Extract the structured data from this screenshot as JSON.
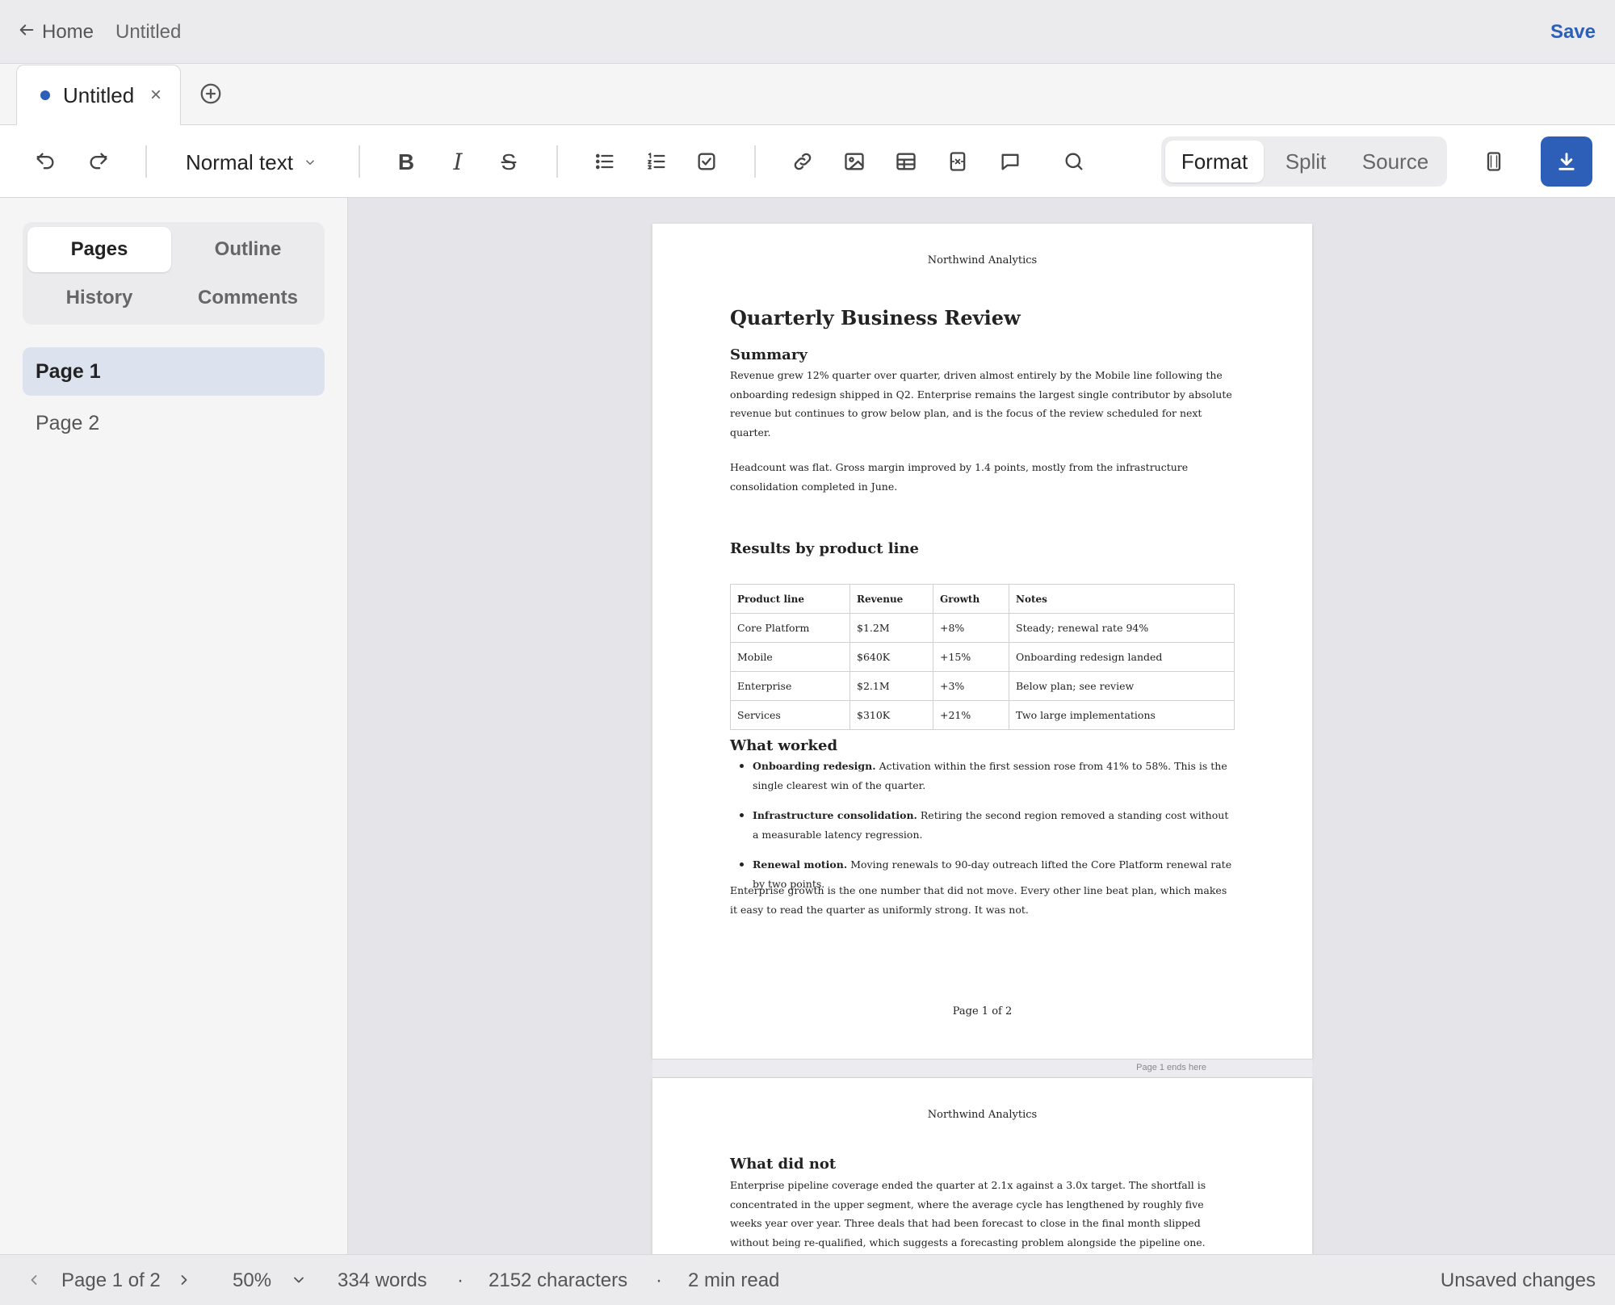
{
  "topbar": {
    "home_label": "Home",
    "doc_title": "Untitled",
    "save_label": "Save"
  },
  "tab": {
    "label": "Untitled",
    "close_glyph": "×"
  },
  "toolbar": {
    "text_style": "Normal text",
    "bold": "B",
    "italic": "I",
    "strike": "S",
    "modes": [
      "Format",
      "Split",
      "Source"
    ],
    "active_mode": "Format"
  },
  "sidebar": {
    "tabs": [
      "Pages",
      "Outline",
      "History",
      "Comments"
    ],
    "active_tab": "Pages",
    "pages": [
      "Page 1",
      "Page 2"
    ],
    "active_page": "Page 1"
  },
  "document": {
    "page1": {
      "header": "Northwind Analytics",
      "title": "Quarterly Business Review",
      "summary_heading": "Summary",
      "summary_p1": "Revenue grew 12% quarter over quarter, driven almost entirely by the Mobile line following the onboarding redesign shipped in Q2. Enterprise remains the largest single contributor by absolute revenue but continues to grow below plan, and is the focus of the review scheduled for next quarter.",
      "summary_p2": "Headcount was flat. Gross margin improved by 1.4 points, mostly from the infrastructure consolidation completed in June.",
      "results_heading": "Results by product line",
      "table": {
        "headers": [
          "Product line",
          "Revenue",
          "Growth",
          "Notes"
        ],
        "rows": [
          [
            "Core Platform",
            "$1.2M",
            "+8%",
            "Steady; renewal rate 94%"
          ],
          [
            "Mobile",
            "$640K",
            "+15%",
            "Onboarding redesign landed"
          ],
          [
            "Enterprise",
            "$2.1M",
            "+3%",
            "Below plan; see review"
          ],
          [
            "Services",
            "$310K",
            "+21%",
            "Two large implementations"
          ]
        ]
      },
      "worked_heading": "What worked",
      "bullets": [
        {
          "lead": "Onboarding redesign.",
          "text": "Activation within the first session rose from 41% to 58%. This is the single clearest win of the quarter."
        },
        {
          "lead": "Infrastructure consolidation.",
          "text": "Retiring the second region removed a standing cost without a measurable latency regression."
        },
        {
          "lead": "Renewal motion.",
          "text": "Moving renewals to 90-day outreach lifted the Core Platform renewal rate by two points."
        }
      ],
      "closing": "Enterprise growth is the one number that did not move. Every other line beat plan, which makes it easy to read the quarter as uniformly strong. It was not.",
      "footer": "Page 1 of 2"
    },
    "page_break_label": "Page 1 ends here",
    "page2": {
      "header": "Northwind Analytics",
      "heading": "What did not",
      "paragraph": "Enterprise pipeline coverage ended the quarter at 2.1x against a 3.0x target. The shortfall is concentrated in the upper segment, where the average cycle has lengthened by roughly five weeks year over year. Three deals that had been forecast to close in the final month slipped without being re-qualified, which suggests a forecasting problem alongside the pipeline one."
    }
  },
  "statusbar": {
    "page_indicator": "Page 1 of 2",
    "zoom": "50%",
    "words": "334 words",
    "characters": "2152 characters",
    "read_time": "2 min read",
    "separator": "·",
    "save_state": "Unsaved changes"
  },
  "colors": {
    "accent": "#2d5fb8",
    "active_page_bg": "#dde2ef"
  },
  "icons": [
    "arrow-left-icon",
    "plus-circle-icon",
    "undo-icon",
    "redo-icon",
    "chevron-down-icon",
    "bullet-list-icon",
    "numbered-list-icon",
    "checkbox-icon",
    "link-icon",
    "image-icon",
    "table-icon",
    "page-break-icon",
    "comment-icon",
    "search-icon",
    "page-view-icon",
    "download-icon",
    "chevron-left-icon",
    "chevron-right-icon"
  ]
}
